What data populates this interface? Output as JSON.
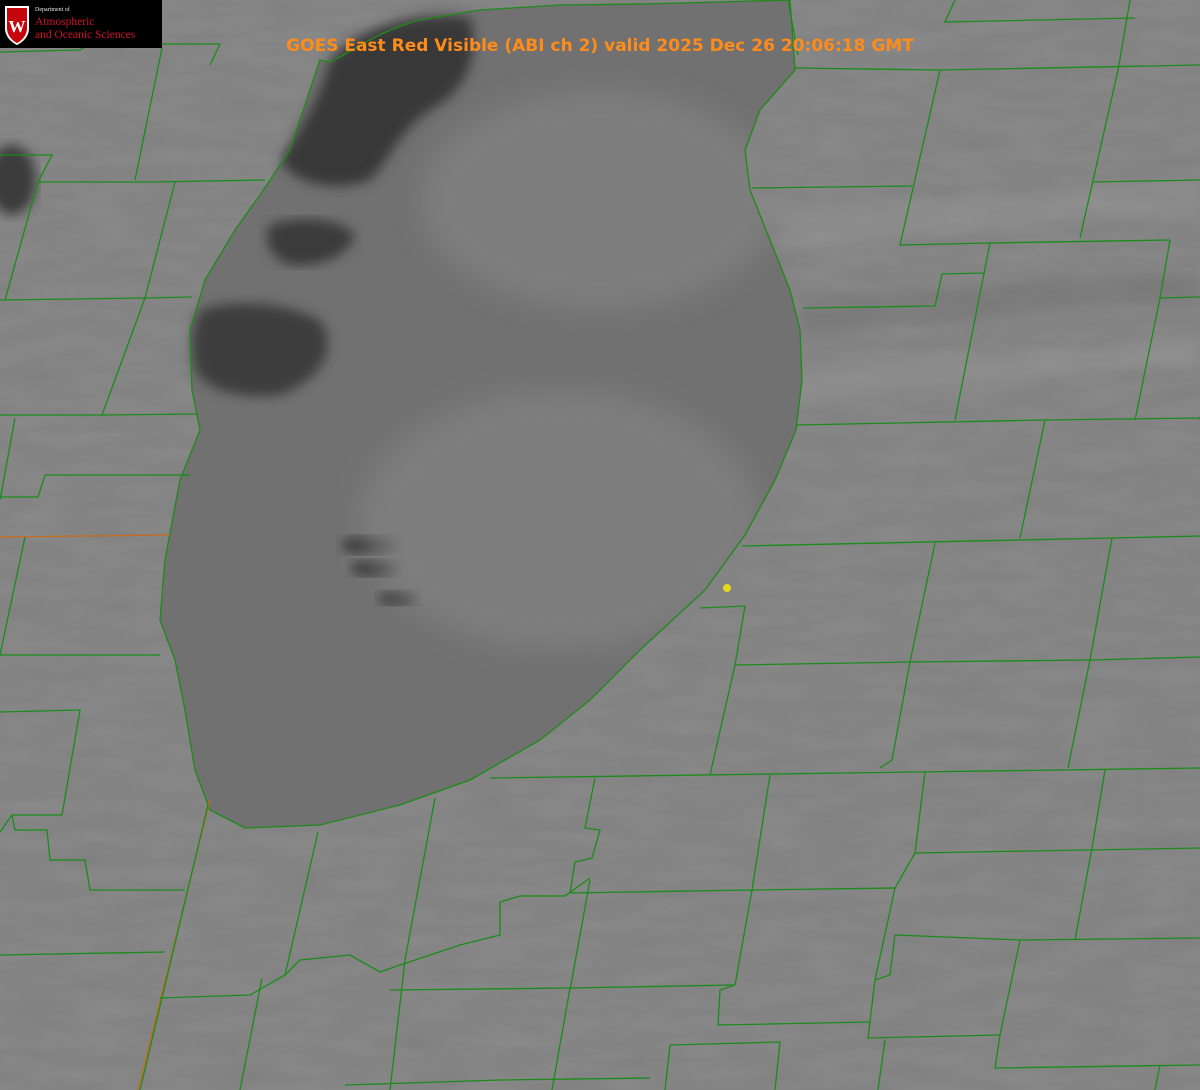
{
  "title": "GOES East Red Visible (ABI ch 2) valid 2025 Dec 26 20:06:18 GMT",
  "title_color": "#ff8c1a",
  "logo": {
    "department": "Department of",
    "name_line1": "Atmospheric",
    "name_line2": "and Oceanic Sciences",
    "seal_letter": "W",
    "seal_color": "#c5050c",
    "text_color": "#d0102a"
  },
  "overlay_colors": {
    "county_boundaries": "#1a8c1a",
    "lake_shoreline_dotted": "#e23c3c",
    "marker": "#e6d61a"
  }
}
